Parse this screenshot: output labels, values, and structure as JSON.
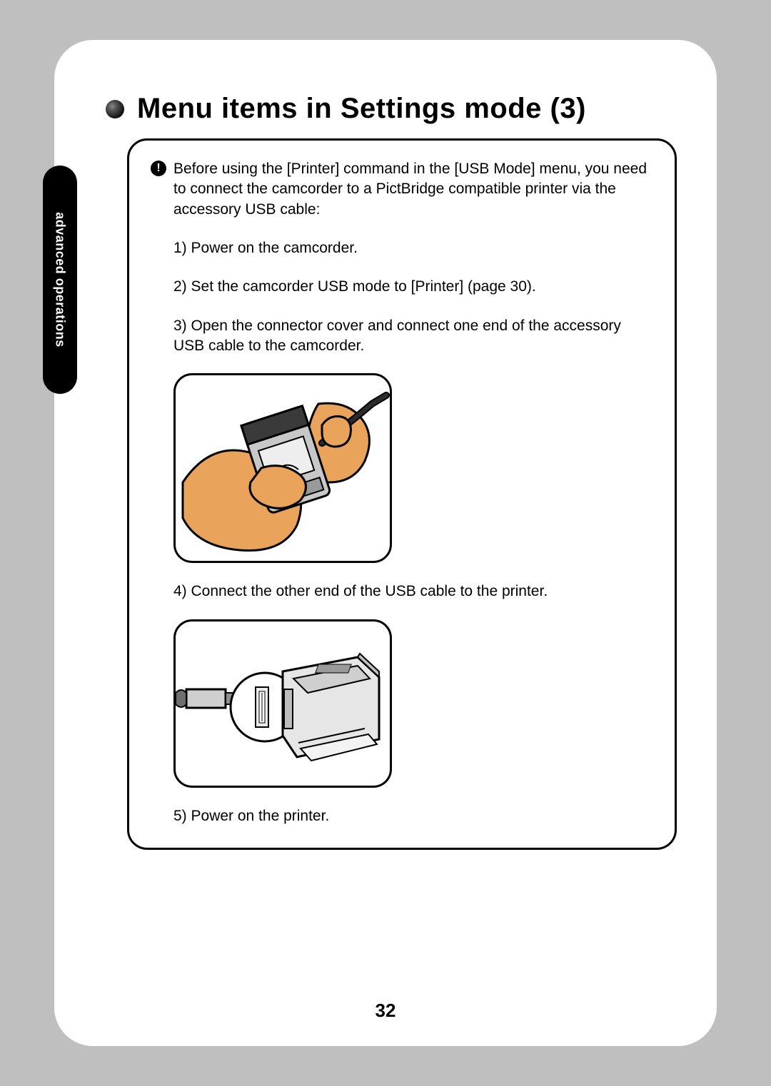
{
  "side_tab": {
    "label": "advanced operations"
  },
  "heading": {
    "title": "Menu items in Settings mode (3)"
  },
  "info": {
    "alert_glyph": "!",
    "intro": "Before using the [Printer] command in the [USB Mode] menu, you need to connect the camcorder to a PictBridge compatible printer via the accessory USB cable:",
    "step1": "1) Power on the camcorder.",
    "step2": "2) Set the camcorder USB mode to [Printer] (page 30).",
    "step3": "3) Open the connector cover and connect one end of the accessory USB cable to the camcorder.",
    "step4": "4) Connect the other end of the USB cable to the printer.",
    "step5": "5) Power on the printer."
  },
  "page_number": "32"
}
